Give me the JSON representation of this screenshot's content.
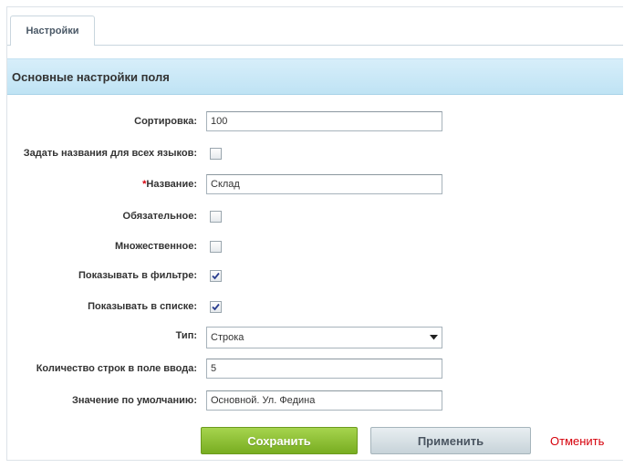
{
  "tabs": [
    {
      "label": "Настройки",
      "active": true
    }
  ],
  "section_title": "Основные настройки поля",
  "fields": {
    "sort": {
      "label": "Сортировка:",
      "value": "100"
    },
    "all_languages": {
      "label": "Задать названия для всех языков:",
      "checked": false
    },
    "name": {
      "required_mark": "*",
      "label": "Название:",
      "value": "Склад"
    },
    "required": {
      "label": "Обязательное:",
      "checked": false
    },
    "multiple": {
      "label": "Множественное:",
      "checked": false
    },
    "show_in_filter": {
      "label": "Показывать в фильтре:",
      "checked": true
    },
    "show_in_list": {
      "label": "Показывать в списке:",
      "checked": true
    },
    "type": {
      "label": "Тип:",
      "value": "Строка"
    },
    "rows_count": {
      "label": "Количество строк в поле ввода:",
      "value": "5"
    },
    "default_value": {
      "label": "Значение по умолчанию:",
      "value": "Основной. Ул. Федина"
    }
  },
  "buttons": {
    "save": "Сохранить",
    "apply": "Применить",
    "cancel": "Отменить"
  },
  "colors": {
    "save_button": "#8cc034",
    "cancel_link": "#d6000b",
    "section_header": "#c8e8f7"
  }
}
